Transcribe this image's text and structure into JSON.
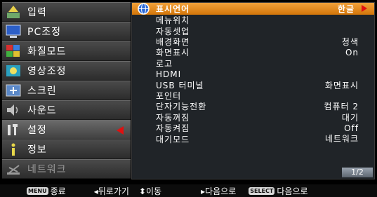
{
  "left_menu": [
    {
      "label": "입력",
      "icon": "input-icon"
    },
    {
      "label": "PC조정",
      "icon": "pc-monitor-icon"
    },
    {
      "label": "화질모드",
      "icon": "image-mode-icon"
    },
    {
      "label": "영상조정",
      "icon": "image-adjust-icon"
    },
    {
      "label": "스크린",
      "icon": "screen-icon"
    },
    {
      "label": "사운드",
      "icon": "sound-icon"
    },
    {
      "label": "설정",
      "icon": "settings-tools-icon"
    },
    {
      "label": "정보",
      "icon": "info-icon"
    },
    {
      "label": "네트워크",
      "icon": "network-icon"
    }
  ],
  "right_menu": [
    {
      "label": "표시언어",
      "value": "한글"
    },
    {
      "label": "메뉴위치",
      "value": ""
    },
    {
      "label": "자동셋업",
      "value": ""
    },
    {
      "label": "배경화면",
      "value": "청색"
    },
    {
      "label": "화면표시",
      "value": "On"
    },
    {
      "label": "로고",
      "value": ""
    },
    {
      "label": "HDMI",
      "value": ""
    },
    {
      "label": "USB 터미널",
      "value": "화면표시"
    },
    {
      "label": "포인터",
      "value": ""
    },
    {
      "label": "단자기능전환",
      "value": "컴퓨터 2"
    },
    {
      "label": "자동꺼짐",
      "value": "대기"
    },
    {
      "label": "자동켜짐",
      "value": "Off"
    },
    {
      "label": "대기모드",
      "value": "네트워크"
    }
  ],
  "page_indicator": "1/2",
  "bottom_bar": {
    "menu_tag": "MENU",
    "exit": "종료",
    "back": "◂뒤로가기",
    "move": "⬍이동",
    "next": "▸다음으로",
    "select_tag": "SELECT",
    "select": "다음으로"
  },
  "colors": {
    "accent": "#e8901e",
    "arrow": "#e01010"
  }
}
